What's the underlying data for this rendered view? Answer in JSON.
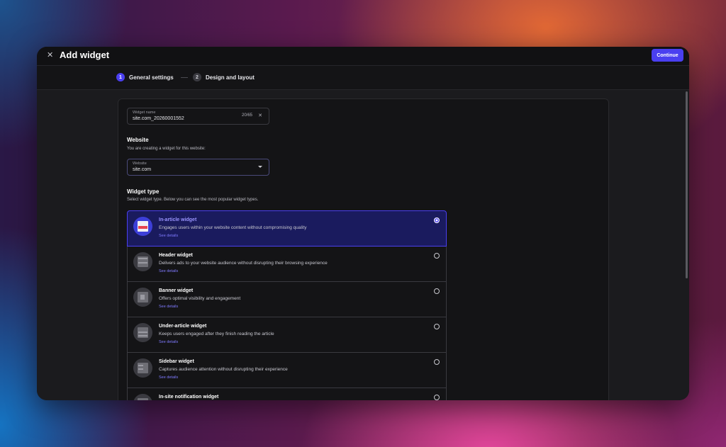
{
  "header": {
    "title": "Add widget",
    "close_icon": "close-icon",
    "continue_label": "Continue"
  },
  "stepper": {
    "steps": [
      {
        "number": "1",
        "label": "General settings",
        "active": true
      },
      {
        "number": "2",
        "label": "Design and layout",
        "active": false
      }
    ]
  },
  "widget_name": {
    "label": "Widget name",
    "value": "site.com_20260001552",
    "counter": "20/65",
    "clear_icon": "close-icon"
  },
  "website_section": {
    "title": "Website",
    "description": "You are creating a widget for this website:",
    "select_label": "Website",
    "select_value": "site.com"
  },
  "widget_type_section": {
    "title": "Widget type",
    "description": "Select widget type. Below you can see the most popular widget types.",
    "options": [
      {
        "title": "In-article widget",
        "description": "Engages users within your website content without compromising quality",
        "link": "See details",
        "selected": true
      },
      {
        "title": "Header widget",
        "description": "Delivers ads to your website audience without disrupting their browsing experience",
        "link": "See details",
        "selected": false
      },
      {
        "title": "Banner widget",
        "description": "Offers optimal visibility and engagement",
        "link": "See details",
        "selected": false
      },
      {
        "title": "Under-article widget",
        "description": "Keeps users engaged after they finish reading the article",
        "link": "See details",
        "selected": false
      },
      {
        "title": "Sidebar widget",
        "description": "Captures audience attention without disrupting their experience",
        "link": "See details",
        "selected": false
      },
      {
        "title": "In-site notification widget",
        "description": "",
        "link": "",
        "selected": false
      }
    ]
  },
  "colors": {
    "accent": "#4a3ff0",
    "selected_bg": "#1a1b5e",
    "link": "#7f7aff"
  }
}
